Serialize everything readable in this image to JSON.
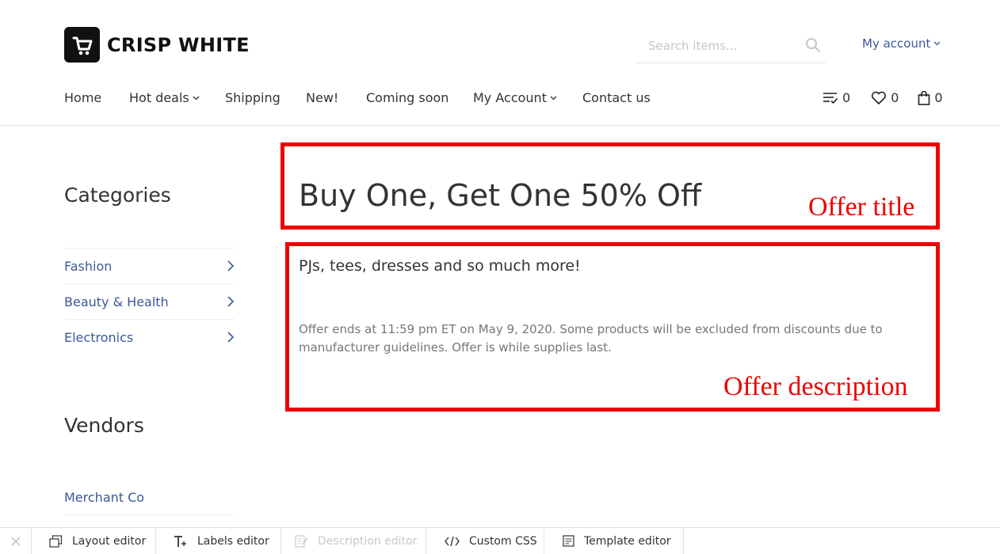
{
  "header": {
    "brand": "CRISP WHITE",
    "search_placeholder": "Search items...",
    "my_account": "My account"
  },
  "nav": {
    "items": [
      {
        "label": "Home",
        "dropdown": false
      },
      {
        "label": "Hot deals",
        "dropdown": true
      },
      {
        "label": "Shipping",
        "dropdown": false
      },
      {
        "label": "New!",
        "dropdown": false
      },
      {
        "label": "Coming soon",
        "dropdown": false
      },
      {
        "label": "My Account",
        "dropdown": true
      },
      {
        "label": "Contact us",
        "dropdown": false
      }
    ],
    "compare_count": "0",
    "wishlist_count": "0",
    "cart_count": "0"
  },
  "sidebar": {
    "categories_title": "Categories",
    "categories": [
      "Fashion",
      "Beauty & Health",
      "Electronics"
    ],
    "vendors_title": "Vendors",
    "vendors": [
      "Merchant Co"
    ]
  },
  "offer": {
    "title": "Buy One, Get One 50% Off",
    "subtitle": "PJs, tees, dresses and so much more!",
    "note": "Offer ends at 11:59 pm ET on May 9, 2020. Some products will be excluded from discounts due to manufacturer guidelines. Offer is while supplies last.",
    "title_annotation": "Offer title",
    "description_annotation": "Offer description"
  },
  "toolbar": {
    "layout_editor": "Layout editor",
    "labels_editor": "Labels editor",
    "description_editor": "Description editor",
    "custom_css": "Custom CSS",
    "template_editor": "Template editor"
  },
  "colors": {
    "link": "#3b5998",
    "annotation": "#ee0000",
    "text": "#333333"
  }
}
